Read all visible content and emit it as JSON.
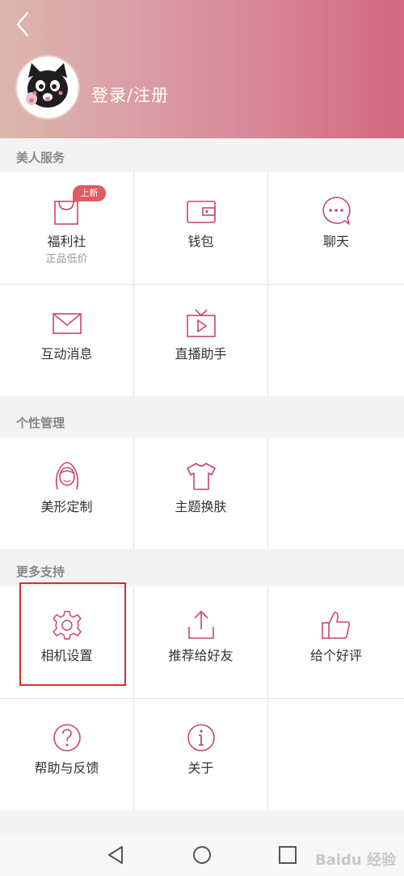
{
  "header": {
    "login_label": "登录/注册"
  },
  "sections": {
    "beauty_services": {
      "title": "美人服务",
      "items": [
        {
          "label": "福利社",
          "sublabel": "正品低价",
          "badge": "上新",
          "icon": "shopping-bag-icon"
        },
        {
          "label": "钱包",
          "icon": "wallet-icon"
        },
        {
          "label": "聊天",
          "icon": "chat-bubble-icon"
        },
        {
          "label": "互动消息",
          "icon": "envelope-icon"
        },
        {
          "label": "直播助手",
          "icon": "tv-play-icon"
        }
      ]
    },
    "personal": {
      "title": "个性管理",
      "items": [
        {
          "label": "美形定制",
          "icon": "face-icon"
        },
        {
          "label": "主题换肤",
          "icon": "tshirt-icon"
        }
      ]
    },
    "support": {
      "title": "更多支持",
      "items": [
        {
          "label": "相机设置",
          "icon": "gear-icon"
        },
        {
          "label": "推荐给好友",
          "icon": "share-upload-icon"
        },
        {
          "label": "给个好评",
          "icon": "thumbs-up-icon"
        },
        {
          "label": "帮助与反馈",
          "icon": "help-icon"
        },
        {
          "label": "关于",
          "icon": "info-icon"
        }
      ]
    }
  },
  "watermark": "Baidu 经验",
  "colors": {
    "accent": "#c9466a",
    "header_start": "#dcb7ae",
    "header_end": "#d4687f",
    "badge": "#e05a5f",
    "highlight": "#d32f2f"
  }
}
